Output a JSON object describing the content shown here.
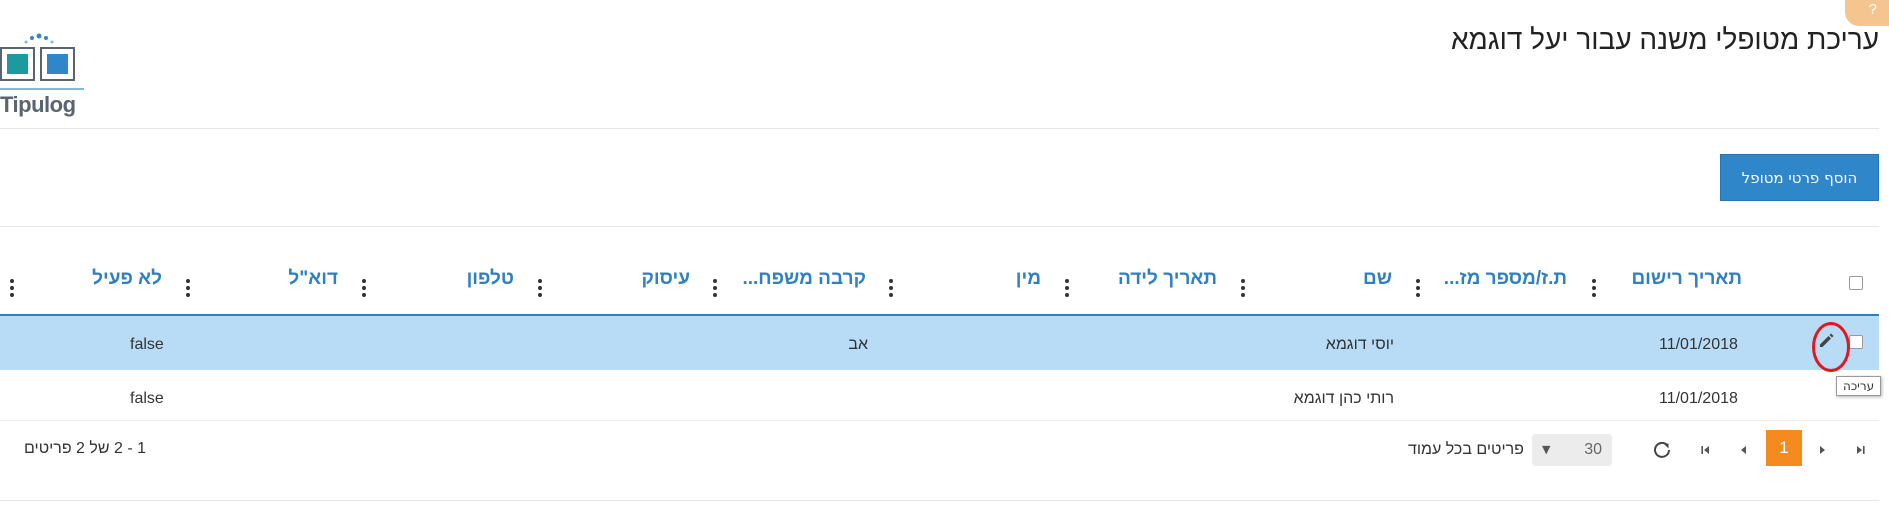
{
  "app": {
    "logo_text": "Tipulog",
    "help_icon": "question-icon"
  },
  "page": {
    "title": "עריכת מטופלי משנה עבור יעל דוגמא"
  },
  "toolbar": {
    "add_label": "הוסף פרטי מטופל"
  },
  "table": {
    "columns": [
      "תאריך רישום",
      "ת.ז/מספר מז...",
      "שם",
      "תאריך לידה",
      "מין",
      "קרבה משפח...",
      "עיסוק",
      "טלפון",
      "דוא\"ל",
      "לא פעיל"
    ],
    "rows": [
      {
        "registration_date": "11/01/2018",
        "id_number": "",
        "name": "יוסי דוגמא",
        "birth_date": "",
        "gender": "",
        "family_relation": "אב",
        "occupation": "",
        "phone": "",
        "email": "",
        "inactive": "false",
        "selected": true
      },
      {
        "registration_date": "11/01/2018",
        "id_number": "",
        "name": "רותי כהן דוגמא",
        "birth_date": "",
        "gender": "",
        "family_relation": "",
        "occupation": "",
        "phone": "",
        "email": "",
        "inactive": "false",
        "selected": false
      }
    ],
    "edit_tooltip": "עריכה"
  },
  "pager": {
    "current_page": "1",
    "page_size": "30",
    "per_page_label": "פריטים בכל עמוד",
    "info": "1 - 2 של 2 פריטים"
  },
  "colors": {
    "accent": "#2f86c9",
    "header_text": "#2f7fc1",
    "selected_row": "#b8dcf6",
    "pager_active": "#f58b1f",
    "edit_highlight": "#e01820"
  }
}
